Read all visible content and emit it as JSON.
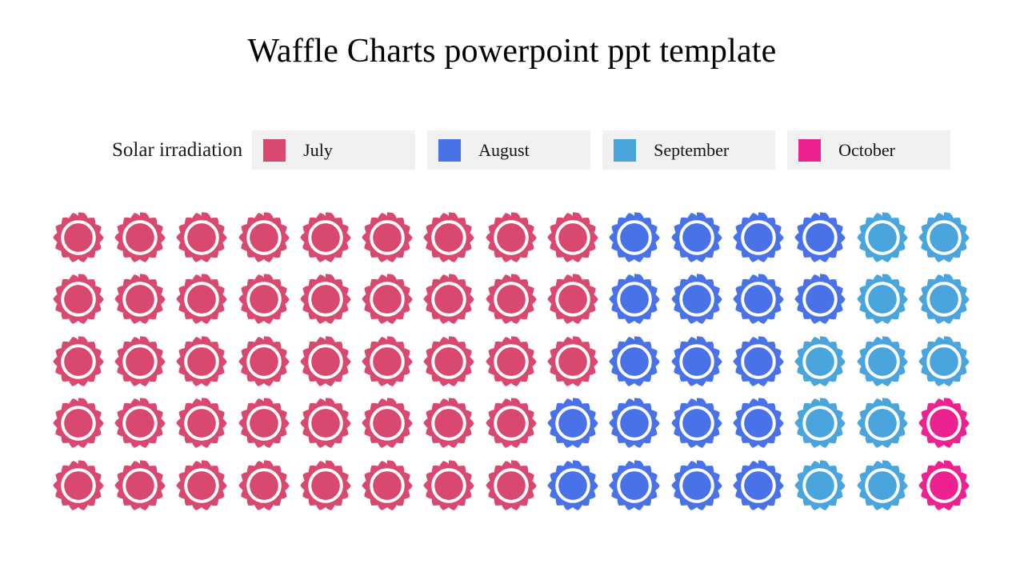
{
  "slide": {
    "title": "Waffle Charts powerpoint ppt template",
    "background_color": "#ffffff"
  },
  "legend": {
    "caption": "Solar irradiation",
    "background_color": "#f1f1f1",
    "items": [
      {
        "label": "July",
        "color": "#d8486f",
        "key": "july"
      },
      {
        "label": "August",
        "color": "#4a72e8",
        "key": "august"
      },
      {
        "label": "September",
        "color": "#49a5dc",
        "key": "september"
      },
      {
        "label": "October",
        "color": "#ee2190",
        "key": "october"
      }
    ]
  },
  "chart_data": {
    "type": "waffle",
    "title": "Waffle Charts powerpoint ppt template",
    "xlabel": "",
    "ylabel": "",
    "grid_rows": 5,
    "grid_columns": 15,
    "total_cells": 75,
    "icon": "cog-ring-icon",
    "categories": [
      "July",
      "August",
      "September",
      "October"
    ],
    "values": [
      43,
      19,
      11,
      2
    ],
    "colors": [
      "#d8486f",
      "#4a72e8",
      "#49a5dc",
      "#ee2190"
    ],
    "legend_position": "top",
    "grid": [
      [
        "july",
        "july",
        "july",
        "july",
        "july",
        "july",
        "july",
        "july",
        "july",
        "august",
        "august",
        "august",
        "august",
        "september",
        "september"
      ],
      [
        "july",
        "july",
        "july",
        "july",
        "july",
        "july",
        "july",
        "july",
        "july",
        "august",
        "august",
        "august",
        "august",
        "september",
        "september"
      ],
      [
        "july",
        "july",
        "july",
        "july",
        "july",
        "july",
        "july",
        "july",
        "july",
        "august",
        "august",
        "august",
        "september",
        "september",
        "september"
      ],
      [
        "july",
        "july",
        "july",
        "july",
        "july",
        "july",
        "july",
        "july",
        "august",
        "august",
        "august",
        "august",
        "september",
        "september",
        "october"
      ],
      [
        "july",
        "july",
        "july",
        "july",
        "july",
        "july",
        "july",
        "july",
        "august",
        "august",
        "august",
        "august",
        "september",
        "september",
        "october"
      ]
    ]
  }
}
